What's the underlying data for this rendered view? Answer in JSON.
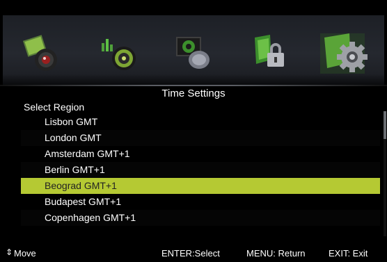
{
  "icons": [
    {
      "name": "picture-icon"
    },
    {
      "name": "sound-icon"
    },
    {
      "name": "channel-icon"
    },
    {
      "name": "lock-icon"
    },
    {
      "name": "settings-icon"
    }
  ],
  "header": {
    "title": "Time Settings"
  },
  "section": {
    "label": "Select Region"
  },
  "regions": [
    "Lisbon GMT",
    "London GMT",
    "Amsterdam GMT+1",
    "Berlin GMT+1",
    "Beograd GMT+1",
    "Budapest GMT+1",
    "Copenhagen GMT+1"
  ],
  "selected_region": "Beograd GMT+1",
  "footer": {
    "move_symbol": "⇕",
    "move": "Move",
    "enter": "ENTER:Select",
    "menu": "MENU: Return",
    "exit": "EXIT: Exit"
  },
  "colors": {
    "highlight": "#b5c933",
    "background": "#000000"
  }
}
